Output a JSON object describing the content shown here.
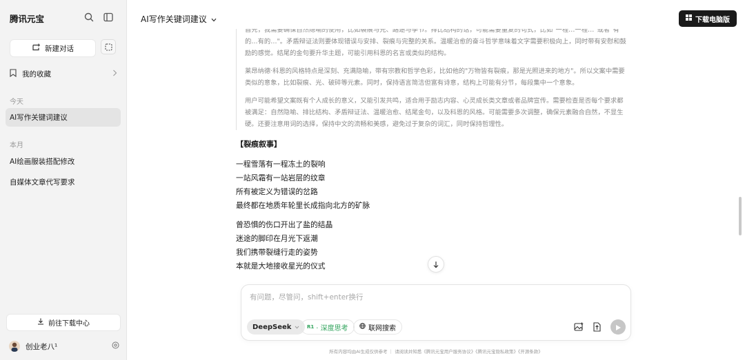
{
  "sidebar": {
    "brand": "腾讯元宝",
    "new_chat_label": "新建对话",
    "favorites_label": "我的收藏",
    "today_label": "今天",
    "today_items": [
      {
        "label": "AI写作关键词建议"
      }
    ],
    "month_label": "本月",
    "month_items": [
      {
        "label": "AI绘画服装搭配修改"
      },
      {
        "label": "自媒体文章代写要求"
      }
    ],
    "download_center_label": "前往下载中心",
    "user_name": "创业老八¹"
  },
  "header": {
    "title": "AI写作关键词建议",
    "download_pc_label": "下载电脑版"
  },
  "thinking": [
    "首先，我需要确保自然隐喻的使用，比如裂痕与光、路途与季节。排比结构的话，可能需要重复的句式，比如\"一程…一程…\"或者\"有的…有的…\"。矛盾辩证法则要体现错误与安排、裂痕与完整的关系。温暖治愈的奋斗哲学意味着文字需要积极向上，同时带有安慰和鼓励的感觉。结尾的金句要升华主题，可能引用科恩的名言或类似的结构。",
    "莱昂纳德·科恩的风格特点是深刻、充满隐喻，带有宗教和哲学色彩，比如他的\"万物皆有裂痕，那是光照进来的地方\"。所以文案中需要类似的意象，比如裂痕、光、破碎等元素。同时，保持语言简洁但富有诗意，结构上可能有分节，每段集中一个意象。",
    "用户可能希望文案既有个人成长的意义，又能引发共鸣，适合用于励志内容、心灵成长类文章或者品牌宣传。需要检查是否每个要求都被满足：自然隐喻、排比结构、矛盾辩证法、温暖治愈、结尾金句，以及科恩的风格。可能需要多次调整，确保元素融合自然，不显生硬。还要注意用词的选择，保持中文的流畅和美感，避免过于复杂的词汇，同时保持哲理性。"
  ],
  "answer": {
    "section_title": "【裂痕叙事】",
    "stanzas": [
      [
        "一程雪落有一程冻土的裂响",
        "一站风霜有一站岩层的纹章",
        "所有被定义为错误的岔路",
        "最终都在地质年轮里长成指向北方的矿脉"
      ],
      [
        "曾恐惧的伤口开出了盐的结晶",
        "迷途的脚印在月光下返潮",
        "我们携带裂缝行走的姿势",
        "本就是大地接收星光的仪式"
      ]
    ]
  },
  "input": {
    "placeholder": "有问题，尽管问，shift+enter换行",
    "model_label": "DeepSeek",
    "deep_think_badge": "R1",
    "deep_think_label": "· 深度思考",
    "web_search_label": "联网搜索"
  },
  "footer": "所有内容均由AI生成仅供参考 ｜ 请阅读并知悉《腾讯元宝用户服务协议》《腾讯元宝隐私政策》《开源条款》",
  "colors": {
    "sidebar_bg": "#f3f3f3",
    "active_item_bg": "#e4e4e4",
    "deep_think_green": "#2fa35b",
    "download_btn_bg": "#1a1a1a"
  }
}
